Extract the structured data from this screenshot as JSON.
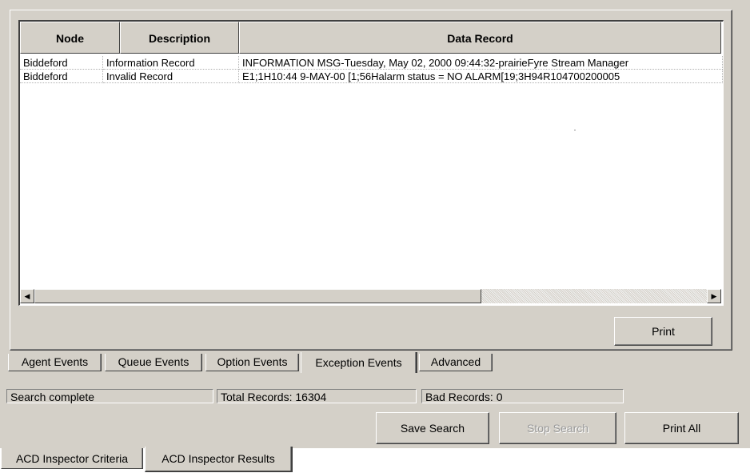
{
  "table": {
    "columns": [
      "Node",
      "Description",
      "Data Record"
    ],
    "rows": [
      {
        "node": "Biddeford",
        "description": "Information Record",
        "data_record": "INFORMATION MSG-Tuesday, May 02, 2000 09:44:32-prairieFyre Stream Manager"
      },
      {
        "node": "Biddeford",
        "description": "Invalid Record",
        "data_record": "E1;1H10:44   9-MAY-00 [1;56Halarm status = NO ALARM[19;3H94R104700200005"
      }
    ],
    "scroll_left_icon": "arrow-left-icon",
    "scroll_right_icon": "arrow-right-icon"
  },
  "print_label": "Print",
  "event_tabs": [
    "Agent Events",
    "Queue Events",
    "Option Events",
    "Exception Events",
    "Advanced"
  ],
  "active_event_tab": "Exception Events",
  "status": {
    "message": "Search complete",
    "total_records": "Total Records: 16304",
    "bad_records": "Bad Records: 0"
  },
  "actions": {
    "save_search": "Save Search",
    "stop_search": "Stop Search",
    "print_all": "Print All"
  },
  "bottom_tabs": [
    "ACD Inspector Criteria",
    "ACD Inspector Results"
  ],
  "active_bottom_tab": "ACD Inspector Results"
}
